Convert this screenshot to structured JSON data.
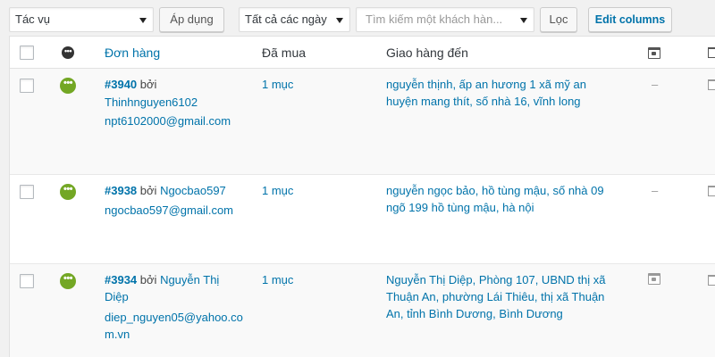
{
  "toolbar": {
    "bulk_action": "Tác vụ",
    "apply_label": "Áp dụng",
    "date_filter": "Tất cả các ngày",
    "customer_search_placeholder": "Tìm kiếm một khách hàn...",
    "filter_label": "Lọc",
    "edit_columns_label": "Edit columns"
  },
  "columns": {
    "order": "Đơn hàng",
    "purchased": "Đã mua",
    "ship_to": "Giao hàng đến"
  },
  "orders": [
    {
      "number": "#3940",
      "by": "bởi",
      "customer_line1": "Thinhnguyen6102",
      "customer_line2": "",
      "email_line1": "npt6102000@gmail.com",
      "email_line2": "",
      "purchased": "1 mục",
      "ship_line1": "nguyễn thịnh, ấp an hương 1 xã mỹ an",
      "ship_line2": "huyện mang thít, số nhà 16, vĩnh long",
      "ship_line3": "",
      "shipping_mark": "–"
    },
    {
      "number": "#3938",
      "by": "bởi",
      "customer_line1": "Ngocbao597",
      "customer_line2": "",
      "email_line1": "ngocbao597@gmail.com",
      "email_line2": "",
      "purchased": "1 mục",
      "ship_line1": "nguyễn ngọc bảo, hồ tùng mậu, số nhà 09",
      "ship_line2": "ngõ 199 hồ tùng mậu, hà nội",
      "ship_line3": "",
      "shipping_mark": "–"
    },
    {
      "number": "#3934",
      "by": "bởi",
      "customer_line1": "Nguyễn Thị",
      "customer_line2": "Diệp",
      "email_line1": "diep_nguyen05@yahoo.co",
      "email_line2": "m.vn",
      "purchased": "1 mục",
      "ship_line1": "Nguyễn Thị Diệp, Phòng 107, UBND thị xã",
      "ship_line2": "Thuận An, phường Lái Thiêu, thị xã Thuận",
      "ship_line3": "An, tỉnh Bình Dương, Bình Dương",
      "shipping_mark": ""
    }
  ]
}
